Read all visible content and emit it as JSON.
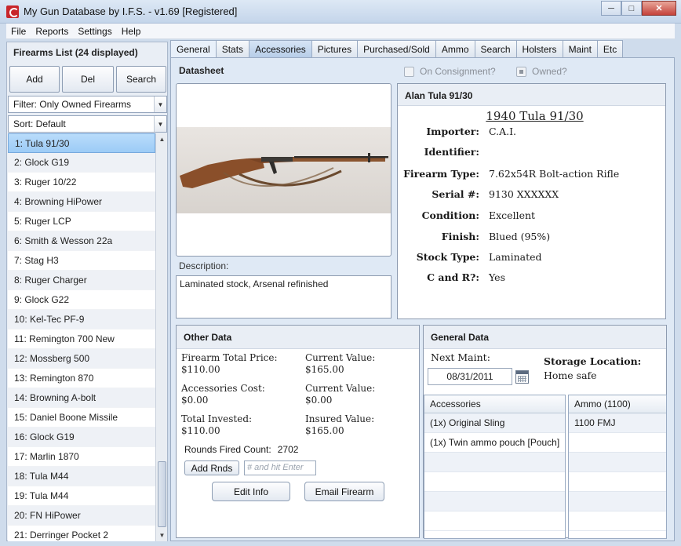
{
  "window": {
    "title": "My Gun Database by I.F.S. - v1.69 [Registered]"
  },
  "menu": [
    "File",
    "Reports",
    "Settings",
    "Help"
  ],
  "left": {
    "header": "Firearms List (24 displayed)",
    "add_label": "Add",
    "del_label": "Del",
    "search_label": "Search",
    "filter": "Filter: Only Owned Firearms",
    "sort": "Sort: Default",
    "items": [
      "1: Tula 91/30",
      "2: Glock G19",
      "3: Ruger 10/22",
      "4: Browning HiPower",
      "5: Ruger LCP",
      "6: Smith & Wesson 22a",
      "7: Stag H3",
      "8: Ruger Charger",
      "9: Glock G22",
      "10: Kel-Tec PF-9",
      "11: Remington 700 New",
      "12: Mossberg 500",
      "13: Remington 870",
      "14: Browning A-bolt",
      "15: Daniel Boone Missile",
      "16: Glock G19",
      "17: Marlin 1870",
      "18: Tula M44",
      "19: Tula M44",
      "20: FN HiPower",
      "21: Derringer Pocket 2"
    ],
    "selected_index": 0
  },
  "tabs": [
    "General",
    "Stats",
    "Accessories",
    "Pictures",
    "Purchased/Sold",
    "Ammo",
    "Search",
    "Holsters",
    "Maint",
    "Etc"
  ],
  "active_tab": 0,
  "highlighted_tab": 2,
  "datasheet": {
    "title": "Datasheet",
    "consignment_label": "On Consignment?",
    "owned_label": "Owned?",
    "description_label": "Description:",
    "description": "Laminated stock, Arsenal refinished"
  },
  "card": {
    "header": "Alan Tula 91/30",
    "name": "1940 Tula 91/30",
    "fields": [
      {
        "k": "Importer:",
        "v": "C.A.I."
      },
      {
        "k": "Identifier:",
        "v": ""
      },
      {
        "k": "Firearm Type:",
        "v": "7.62x54R Bolt-action Rifle"
      },
      {
        "k": "Serial #:",
        "v": "9130 XXXXXX"
      },
      {
        "k": "Condition:",
        "v": "Excellent"
      },
      {
        "k": "Finish:",
        "v": "Blued (95%)"
      },
      {
        "k": "Stock Type:",
        "v": "Laminated"
      },
      {
        "k": "C and R?:",
        "v": "Yes"
      }
    ]
  },
  "other": {
    "title": "Other Data",
    "total_price_k": "Firearm Total Price:",
    "total_price_v": "$110.00",
    "current_value_k": "Current Value:",
    "current_value_v": "$165.00",
    "accessories_cost_k": "Accessories Cost:",
    "accessories_cost_v": "$0.00",
    "current_value2_k": "Current Value:",
    "current_value2_v": "$0.00",
    "total_invested_k": "Total Invested:",
    "total_invested_v": "$110.00",
    "insured_value_k": "Insured Value:",
    "insured_value_v": "$165.00",
    "rounds_label": "Rounds Fired Count:",
    "rounds_value": "2702",
    "add_rnds_label": "Add Rnds",
    "rnds_placeholder": "# and hit Enter",
    "edit_label": "Edit Info",
    "email_label": "Email Firearm"
  },
  "general": {
    "title": "General Data",
    "next_maint_label": "Next Maint:",
    "next_maint_date": "08/31/2011",
    "storage_label": "Storage Location:",
    "storage_value": "Home safe",
    "accessories_header": "Accessories",
    "accessories": [
      "(1x) Original Sling",
      "(1x) Twin ammo pouch [Pouch]"
    ],
    "ammo_header": "Ammo (1100)",
    "ammo": [
      "1100 FMJ"
    ]
  }
}
